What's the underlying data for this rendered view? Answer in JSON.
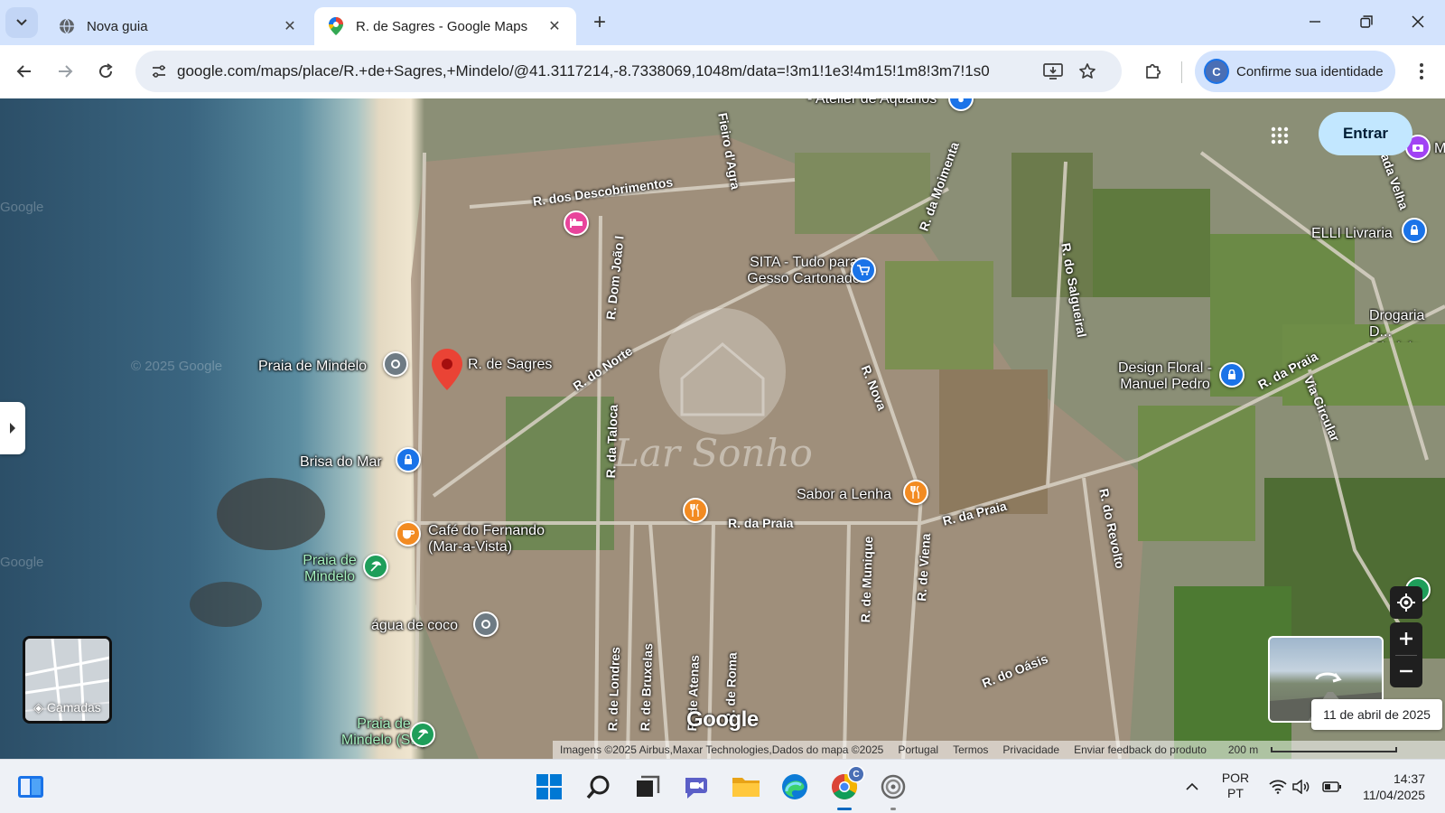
{
  "browser": {
    "tabs": [
      {
        "title": "Nova guia",
        "icon": "globe-icon",
        "active": false
      },
      {
        "title": "R. de Sagres - Google Maps",
        "icon": "google-maps-icon",
        "active": true
      }
    ],
    "url": "google.com/maps/place/R.+de+Sagres,+Mindelo/@41.3117214,-8.7338069,1048m/data=!3m1!1e3!4m15!1m8!3m7!1s0x...",
    "profile": {
      "initial": "C",
      "label": "Confirme sua identidade"
    }
  },
  "maps": {
    "signin_label": "Entrar",
    "layers_label": "Camadas",
    "streetview_date": "11 de abril de 2025",
    "logo": "Google",
    "watermark": "© 2025 Google",
    "watermark_short": "Google",
    "overlay_logo_text": "Lar Sonho",
    "footer": {
      "imagery": "Imagens ©2025 Airbus,Maxar Technologies,Dados do mapa ©2025",
      "country": "Portugal",
      "terms": "Termos",
      "privacy": "Privacidade",
      "feedback": "Enviar feedback do produto",
      "scale": "200 m"
    },
    "pin_label": "R. de Sagres",
    "places": {
      "atelier": "- Atelier de Aquários",
      "praia_mindelo": "Praia de Mindelo",
      "brisa": "Brisa do Mar",
      "cafe": "Café do Fernando (Mar-a-Vista)",
      "praia_mindelo_green": "Praia de Mindelo",
      "agua": "água de coco",
      "praia_sul": "Praia de Mindelo (Sul)",
      "sita": "SITA - Tudo para Gesso Cartonado",
      "sabor": "Sabor a Lenha",
      "design": "Design Floral - Manuel Pedro",
      "elli": "ELLI Livraria",
      "drogaria": "Drogaria D... Mindelo, Lo...",
      "partial_m": "M"
    },
    "streets": {
      "descobrimentos": "R. dos Descobrimentos",
      "dom_joao": "R. Dom João I",
      "do_norte": "R. do Norte",
      "da_taloca": "R. da Taloca",
      "da_praia": "R. da Praia",
      "da_praia_2": "R. da Praia",
      "da_praia_3": "R. da Praia",
      "nova": "R. Nova",
      "moimenta": "R. da Moimenta",
      "salgueiral": "R. do Salgueiral",
      "de_londres": "R. de Londres",
      "de_bruxelas": "R. de Bruxelas",
      "de_atenas": "R. de Atenas",
      "de_roma": "R. de Roma",
      "de_munique": "R. de Munique",
      "de_viena": "R. de Viena",
      "do_revolto": "R. do Revolto",
      "do_oasis": "R. do Oásis",
      "via_circular": "Via Circular",
      "estrada_velha": "Estrada Velha",
      "fieiro": "Fieiro d'Agra"
    }
  },
  "taskbar": {
    "lang_top": "POR",
    "lang_bottom": "PT",
    "time": "14:37",
    "date": "11/04/2025",
    "chrome_badge": "C"
  },
  "colors": {
    "tabstrip": "#d3e3fd",
    "signin_bg": "#c2e7ff",
    "pin": "#ea4335"
  }
}
